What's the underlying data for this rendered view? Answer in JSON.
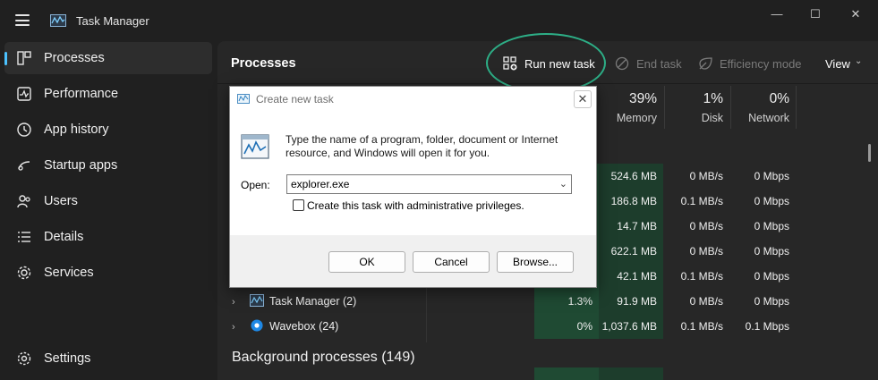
{
  "window": {
    "title": "Task Manager",
    "minimize": "—",
    "maximize": "☐",
    "close": "✕"
  },
  "sidebar": {
    "items": [
      {
        "label": "Processes",
        "icon": "processes-icon"
      },
      {
        "label": "Performance",
        "icon": "performance-icon"
      },
      {
        "label": "App history",
        "icon": "app-history-icon"
      },
      {
        "label": "Startup apps",
        "icon": "startup-apps-icon"
      },
      {
        "label": "Users",
        "icon": "users-icon"
      },
      {
        "label": "Details",
        "icon": "details-icon"
      },
      {
        "label": "Services",
        "icon": "services-icon"
      }
    ],
    "settings": "Settings"
  },
  "toolbar": {
    "title": "Processes",
    "run_new_task": "Run new task",
    "end_task": "End task",
    "efficiency_mode": "Efficiency mode",
    "view": "View"
  },
  "columns": [
    {
      "pct": "39%",
      "name": "Memory"
    },
    {
      "pct": "1%",
      "name": "Disk"
    },
    {
      "pct": "0%",
      "name": "Network"
    }
  ],
  "rows": [
    {
      "name": "",
      "cpu": "",
      "memory": "524.6 MB",
      "disk": "0 MB/s",
      "network": "0 Mbps"
    },
    {
      "name": "",
      "cpu": "",
      "memory": "186.8 MB",
      "disk": "0.1 MB/s",
      "network": "0 Mbps"
    },
    {
      "name": "",
      "cpu": "",
      "memory": "14.7 MB",
      "disk": "0 MB/s",
      "network": "0 Mbps"
    },
    {
      "name": "",
      "cpu": "",
      "memory": "622.1 MB",
      "disk": "0 MB/s",
      "network": "0 Mbps"
    },
    {
      "name": "",
      "cpu": "",
      "memory": "42.1 MB",
      "disk": "0.1 MB/s",
      "network": "0 Mbps"
    },
    {
      "name": "Task Manager (2)",
      "cpu": "1.3%",
      "memory": "91.9 MB",
      "disk": "0 MB/s",
      "network": "0 Mbps"
    },
    {
      "name": "Wavebox (24)",
      "cpu": "0%",
      "memory": "1,037.6 MB",
      "disk": "0.1 MB/s",
      "network": "0.1 Mbps"
    }
  ],
  "background_section": "Background processes (149)",
  "dialog": {
    "title": "Create new task",
    "description": "Type the name of a program, folder, document or Internet resource, and Windows will open it for you.",
    "open_label": "Open:",
    "open_value": "explorer.exe",
    "admin_checkbox": "Create this task with administrative privileges.",
    "ok": "OK",
    "cancel": "Cancel",
    "browse": "Browse..."
  },
  "colors": {
    "accent": "#4cc2ff",
    "highlight": "#2dae86",
    "heat": "#1f4a33"
  }
}
